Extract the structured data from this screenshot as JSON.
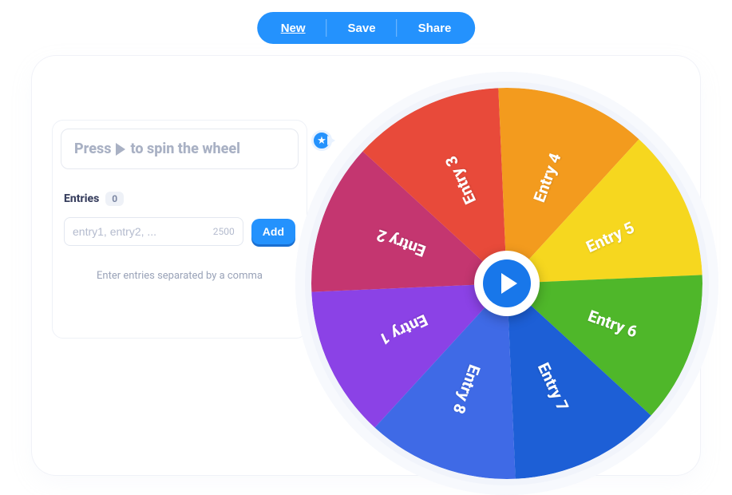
{
  "toolbar": {
    "new_label": "New",
    "save_label": "Save",
    "share_label": "Share"
  },
  "panel": {
    "prompt_prefix": "Press",
    "prompt_suffix": "to spin the wheel",
    "entries_label": "Entries",
    "entries_count": "0",
    "input_placeholder": "entry1, entry2, ...",
    "input_counter": "2500",
    "add_label": "Add",
    "hint": "Enter entries separated by a comma"
  },
  "wheel": {
    "segments": [
      {
        "label": "Entry 1",
        "color": "#8b42e6"
      },
      {
        "label": "Entry 2",
        "color": "#c43670"
      },
      {
        "label": "Entry 3",
        "color": "#e84a3a"
      },
      {
        "label": "Entry 4",
        "color": "#f39b1e"
      },
      {
        "label": "Entry 5",
        "color": "#f6d71f"
      },
      {
        "label": "Entry 6",
        "color": "#4fb72a"
      },
      {
        "label": "Entry 7",
        "color": "#1d5fd6"
      },
      {
        "label": "Entry 8",
        "color": "#3f6ae6"
      }
    ]
  }
}
